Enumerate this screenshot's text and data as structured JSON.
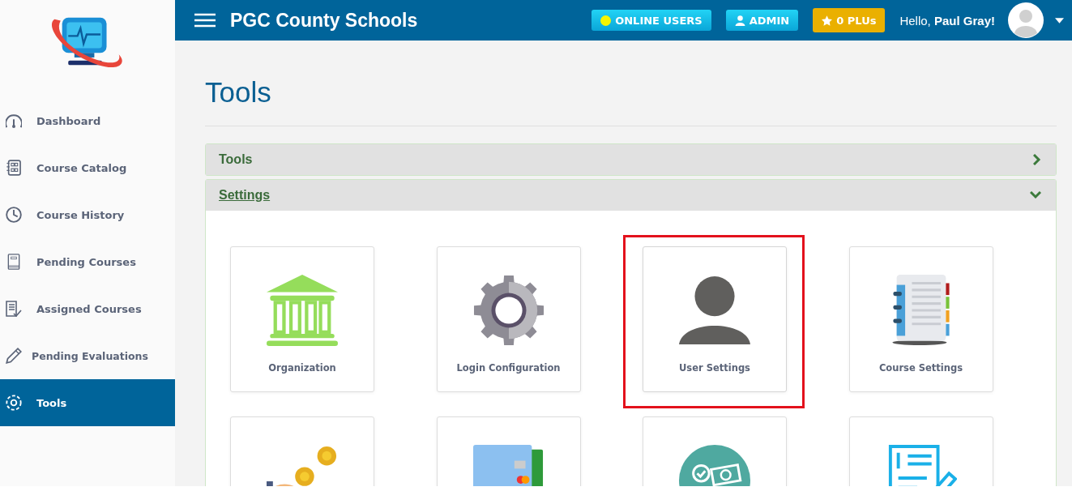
{
  "header": {
    "title": "PGC County Schools",
    "badges": [
      {
        "kind": "dot",
        "label": "ONLINE USERS"
      },
      {
        "kind": "user",
        "label": "ADMIN"
      },
      {
        "kind": "star",
        "label": "0 PLUs"
      }
    ],
    "greeting": "Hello, **Paul Gray!**"
  },
  "sidebar": {
    "items": [
      {
        "kind": "gauge",
        "label": "Dashboard",
        "selected": false
      },
      {
        "kind": "catalog",
        "label": "Course Catalog",
        "selected": false
      },
      {
        "kind": "clock",
        "label": "Course History",
        "selected": false
      },
      {
        "kind": "book",
        "label": "Pending Courses",
        "selected": false
      },
      {
        "kind": "checklist",
        "label": "Assigned Courses",
        "selected": false
      },
      {
        "kind": "pencil",
        "label": "Pending Evaluations",
        "selected": false
      },
      {
        "kind": "gear",
        "label": "Tools",
        "selected": true
      }
    ]
  },
  "page": {
    "title": "Tools"
  },
  "sections": [
    {
      "title": "Tools",
      "expanded": false
    },
    {
      "title": "Settings",
      "expanded": true,
      "tiles": [
        {
          "kind": "bank",
          "label": "Organization",
          "highlighted": false
        },
        {
          "kind": "gear",
          "label": "Login Configuration",
          "highlighted": false
        },
        {
          "kind": "person",
          "label": "User Settings",
          "highlighted": true
        },
        {
          "kind": "notebook",
          "label": "Course Settings",
          "highlighted": false
        },
        {
          "kind": "coins",
          "highlighted": false
        },
        {
          "kind": "card",
          "highlighted": false
        },
        {
          "kind": "money",
          "highlighted": false
        },
        {
          "kind": "document",
          "highlighted": false
        }
      ]
    }
  ]
}
